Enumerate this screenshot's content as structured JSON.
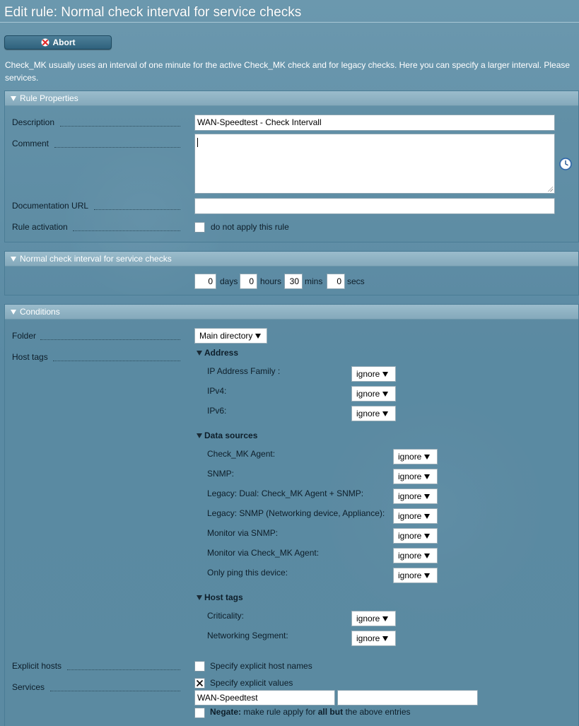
{
  "header": {
    "title": "Edit rule: Normal check interval for service checks",
    "abort_label": "Abort",
    "help_line1": "Check_MK usually uses an interval of one minute for the active Check_MK check and for legacy checks. Here you can specify a larger interval. Please",
    "help_line2": "services."
  },
  "rule_properties": {
    "header": "Rule Properties",
    "description_label": "Description",
    "description_value": "WAN-Speedtest - Check Intervall",
    "comment_label": "Comment",
    "comment_value": "",
    "doc_url_label": "Documentation URL",
    "doc_url_value": "",
    "activation_label": "Rule activation",
    "activation_checkbox_label": "do not apply this rule"
  },
  "interval": {
    "header": "Normal check interval for service checks",
    "days_value": "0",
    "days_label": "days",
    "hours_value": "0",
    "hours_label": "hours",
    "mins_value": "30",
    "mins_label": "mins",
    "secs_value": "0",
    "secs_label": "secs"
  },
  "conditions": {
    "header": "Conditions",
    "folder_label": "Folder",
    "folder_value": "Main directory",
    "host_tags_label": "Host tags",
    "groups": [
      {
        "name": "Address",
        "tags": [
          {
            "label": "IP Address Family :",
            "value": "ignore"
          },
          {
            "label": "IPv4:",
            "value": "ignore"
          },
          {
            "label": "IPv6:",
            "value": "ignore"
          }
        ]
      },
      {
        "name": "Data sources",
        "tags": [
          {
            "label": "Check_MK Agent:",
            "value": "ignore"
          },
          {
            "label": "SNMP:",
            "value": "ignore"
          },
          {
            "label": "Legacy: Dual: Check_MK Agent + SNMP:",
            "value": "ignore"
          },
          {
            "label": "Legacy: SNMP (Networking device, Appliance):",
            "value": "ignore"
          },
          {
            "label": "Monitor via SNMP:",
            "value": "ignore"
          },
          {
            "label": "Monitor via Check_MK Agent:",
            "value": "ignore"
          },
          {
            "label": "Only ping this device:",
            "value": "ignore"
          }
        ]
      },
      {
        "name": "Host tags",
        "tags": [
          {
            "label": "Criticality:",
            "value": "ignore"
          },
          {
            "label": "Networking Segment:",
            "value": "ignore"
          }
        ]
      }
    ],
    "explicit_hosts_label": "Explicit hosts",
    "explicit_hosts_checkbox_label": "Specify explicit host names",
    "services_label": "Services",
    "services_checkbox_label": "Specify explicit values",
    "service_entry_1": "WAN-Speedtest",
    "service_entry_2": "",
    "negate_bold": "Negate:",
    "negate_mid": "make rule apply for",
    "negate_bold2": "all but",
    "negate_end": "the above entries"
  },
  "icons": {
    "abort": "x-icon",
    "comment_helper": "clock-icon"
  },
  "colors": {
    "abort_x": "#e32b2b",
    "section_header": "#8fb3c4",
    "background": "#5f8ea6"
  }
}
